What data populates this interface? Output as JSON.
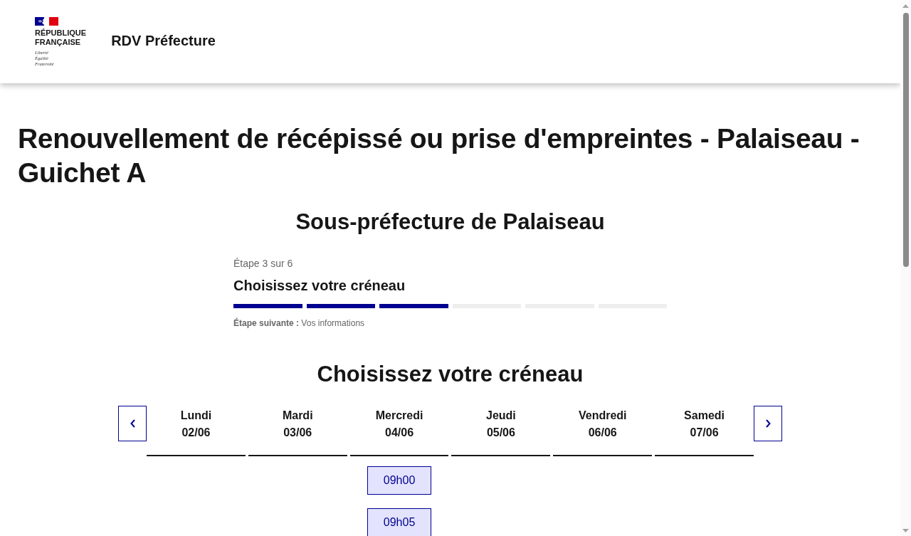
{
  "header": {
    "logo": {
      "name_lines": [
        "RÉPUBLIQUE",
        "FRANÇAISE"
      ],
      "motto": [
        "Liberté",
        "Égalité",
        "Fraternité"
      ]
    },
    "service_name": "RDV Préfecture"
  },
  "page_title": "Renouvellement de récépissé ou prise d'empreintes - Palaiseau - Guichet A",
  "subtitle": "Sous-préfecture de Palaiseau",
  "stepper": {
    "step_label": "Étape 3 sur 6",
    "step_title": "Choisissez votre créneau",
    "steps": [
      {
        "completed": true
      },
      {
        "completed": true
      },
      {
        "completed": true
      },
      {
        "completed": false
      },
      {
        "completed": false
      },
      {
        "completed": false
      }
    ],
    "next_step": "**Étape suivante :** Vos informations"
  },
  "calendar": {
    "heading": "Choisissez votre créneau",
    "days": [
      {
        "name": "Lundi",
        "date": "02/06"
      },
      {
        "name": "Mardi",
        "date": "03/06"
      },
      {
        "name": "Mercredi",
        "date": "04/06",
        "slots": [
          "09h00",
          "09h05"
        ]
      },
      {
        "name": "Jeudi",
        "date": "05/06"
      },
      {
        "name": "Vendredi",
        "date": "06/06"
      },
      {
        "name": "Samedi",
        "date": "07/06"
      }
    ]
  }
}
